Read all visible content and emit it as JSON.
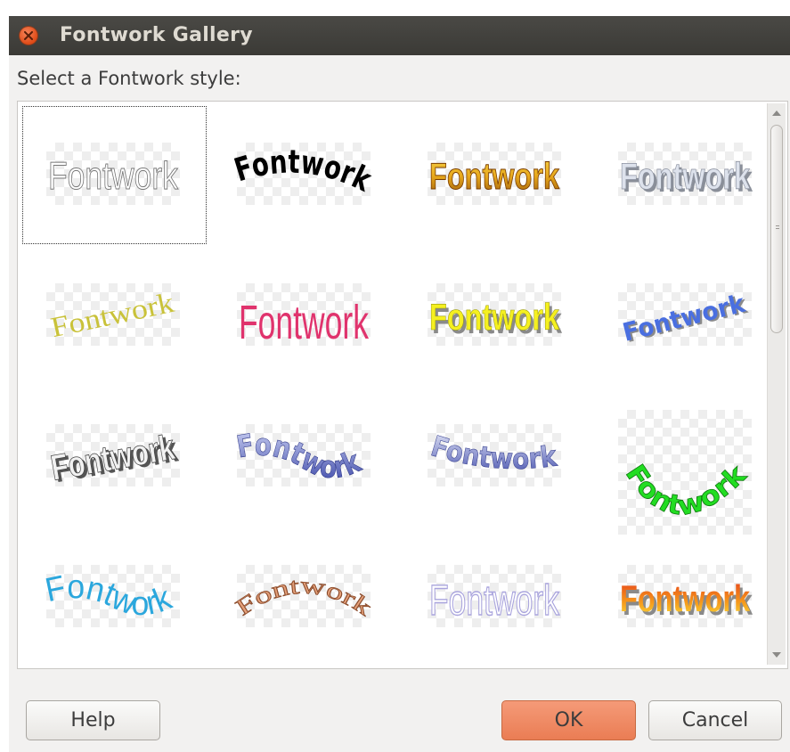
{
  "window": {
    "title": "Fontwork Gallery"
  },
  "prompt": "Select a Fontwork style:",
  "gallery": {
    "items": [
      {
        "label": "Fontwork",
        "style": "outline-white"
      },
      {
        "label": "Fontwork",
        "style": "arch-black"
      },
      {
        "label": "Fontwork",
        "style": "gold-gradient"
      },
      {
        "label": "Fontwork",
        "style": "silver-3d"
      },
      {
        "label": "Fontwork",
        "style": "yellow-slanted"
      },
      {
        "label": "Fontwork",
        "style": "pink-perspective"
      },
      {
        "label": "Fontwork",
        "style": "yellow-3d"
      },
      {
        "label": "Fontwork",
        "style": "blue-slant"
      },
      {
        "label": "Fontwork",
        "style": "gray-perspective"
      },
      {
        "label": "Fontwork",
        "style": "blue-3d-wave"
      },
      {
        "label": "Fontwork",
        "style": "blue-3d-curve"
      },
      {
        "label": "Fontwork",
        "style": "green-arc"
      },
      {
        "label": "Fontwork",
        "style": "cyan-wave"
      },
      {
        "label": "Fontwork",
        "style": "brown-arch"
      },
      {
        "label": "Fontwork",
        "style": "lavender-outline"
      },
      {
        "label": "Fontwork",
        "style": "orange-fire"
      }
    ],
    "selected_index": 0
  },
  "buttons": {
    "help": "Help",
    "ok": "OK",
    "cancel": "Cancel"
  },
  "colors": {
    "titlebar": "#3e3d39",
    "accent": "#ea7d54",
    "close": "#df4a16"
  },
  "icons": {
    "close": "close-icon"
  }
}
